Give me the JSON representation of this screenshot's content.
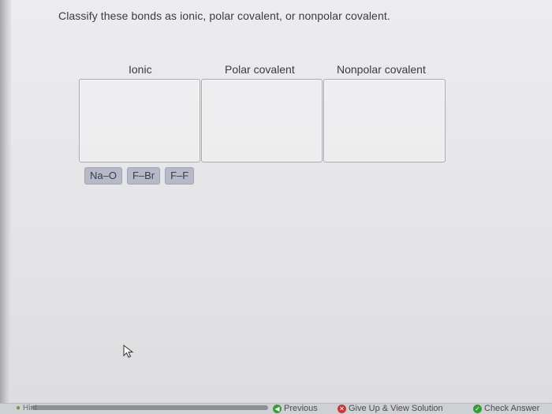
{
  "question": "Classify these bonds as ionic, polar covalent, or nonpolar covalent.",
  "categories": [
    {
      "label": "Ionic"
    },
    {
      "label": "Polar covalent"
    },
    {
      "label": "Nonpolar covalent"
    }
  ],
  "tiles": [
    "Na–O",
    "F–Br",
    "F–F"
  ],
  "footer": {
    "hint": "Hint",
    "previous": "Previous",
    "give_up": "Give Up & View Solution",
    "check": "Check Answer"
  },
  "colors": {
    "tile_bg": "#b6bac8",
    "previous_icon": "#3a9a3a",
    "give_up_icon": "#c23a3a",
    "check_icon": "#3a9a3a"
  }
}
